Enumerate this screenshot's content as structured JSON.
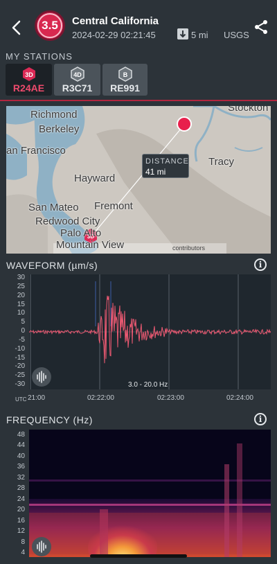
{
  "header": {
    "magnitude": "3.5",
    "title": "Central California",
    "datetime": "2024-02-29 02:21:45",
    "depth": "5 mi",
    "source": "USGS"
  },
  "stations": {
    "label": "MY STATIONS",
    "items": [
      {
        "badge": "3D",
        "code": "R24AE",
        "active": true
      },
      {
        "badge": "4D",
        "code": "R3C71",
        "active": false
      },
      {
        "badge": "B",
        "code": "RE991",
        "active": false
      }
    ]
  },
  "map": {
    "places": [
      "Stockton",
      "Richmond",
      "Berkeley",
      "an Francisco",
      "Hayward",
      "Tracy",
      "Fremont",
      "San Mateo",
      "Redwood City",
      "Palo Alto",
      "Mountain View"
    ],
    "distance_label": "DISTANCE",
    "distance_value": "41 mi",
    "station_badge": "3D",
    "attribution": "contributors"
  },
  "waveform": {
    "title": "WAVEFORM (µm/s)",
    "info": "i",
    "y_ticks": [
      "30",
      "25",
      "20",
      "15",
      "10",
      "5",
      "0",
      "-5",
      "-10",
      "-15",
      "-20",
      "-25",
      "-30"
    ],
    "x_ticks": [
      "21:00",
      "02:22:00",
      "02:23:00",
      "02:24:00"
    ],
    "utc_label": "UTC",
    "filter": "3.0 - 20.0 Hz"
  },
  "frequency": {
    "title": "FREQUENCY (Hz)",
    "info": "i",
    "y_ticks": [
      "48",
      "44",
      "40",
      "36",
      "32",
      "28",
      "24",
      "20",
      "16",
      "12",
      "8",
      "4"
    ]
  },
  "colors": {
    "accent": "#dc2a56",
    "waveform": "#ee5a73",
    "background": "#2c3339"
  }
}
